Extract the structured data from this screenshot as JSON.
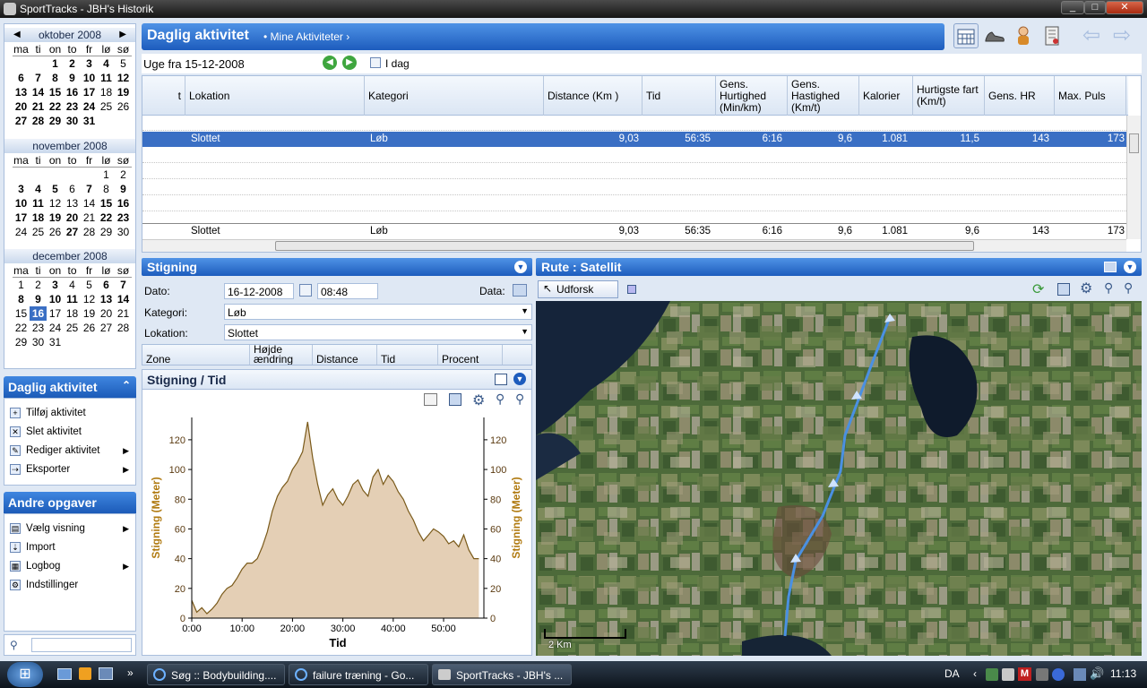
{
  "window": {
    "title": "SportTracks - JBH's Historik",
    "minimize": "_",
    "maximize": "□",
    "close": "✕"
  },
  "calendar": {
    "prev": "◀",
    "next": "▶",
    "weekdays": [
      "ma",
      "ti",
      "on",
      "to",
      "fr",
      "lø",
      "sø"
    ],
    "months": [
      {
        "name": "oktober 2008",
        "days": [
          [
            {
              "d": ""
            },
            {
              "d": ""
            },
            {
              "d": "1",
              "b": true
            },
            {
              "d": "2",
              "b": true
            },
            {
              "d": "3",
              "b": true
            },
            {
              "d": "4",
              "b": true
            },
            {
              "d": "5"
            }
          ],
          [
            {
              "d": "6",
              "b": true
            },
            {
              "d": "7",
              "b": true
            },
            {
              "d": "8",
              "b": true
            },
            {
              "d": "9",
              "b": true
            },
            {
              "d": "10",
              "b": true
            },
            {
              "d": "11",
              "b": true
            },
            {
              "d": "12",
              "b": true
            }
          ],
          [
            {
              "d": "13",
              "b": true
            },
            {
              "d": "14",
              "b": true
            },
            {
              "d": "15",
              "b": true
            },
            {
              "d": "16",
              "b": true
            },
            {
              "d": "17",
              "b": true
            },
            {
              "d": "18"
            },
            {
              "d": "19",
              "b": true
            }
          ],
          [
            {
              "d": "20",
              "b": true
            },
            {
              "d": "21",
              "b": true
            },
            {
              "d": "22",
              "b": true
            },
            {
              "d": "23",
              "b": true
            },
            {
              "d": "24",
              "b": true
            },
            {
              "d": "25"
            },
            {
              "d": "26"
            }
          ],
          [
            {
              "d": "27",
              "b": true
            },
            {
              "d": "28",
              "b": true
            },
            {
              "d": "29",
              "b": true
            },
            {
              "d": "30",
              "b": true
            },
            {
              "d": "31",
              "b": true
            },
            {
              "d": ""
            },
            {
              "d": ""
            }
          ]
        ]
      },
      {
        "name": "november 2008",
        "days": [
          [
            {
              "d": ""
            },
            {
              "d": ""
            },
            {
              "d": ""
            },
            {
              "d": ""
            },
            {
              "d": ""
            },
            {
              "d": "1"
            },
            {
              "d": "2"
            }
          ],
          [
            {
              "d": "3",
              "b": true
            },
            {
              "d": "4",
              "b": true
            },
            {
              "d": "5",
              "b": true
            },
            {
              "d": "6"
            },
            {
              "d": "7",
              "b": true
            },
            {
              "d": "8"
            },
            {
              "d": "9",
              "b": true
            }
          ],
          [
            {
              "d": "10",
              "b": true
            },
            {
              "d": "11",
              "b": true
            },
            {
              "d": "12"
            },
            {
              "d": "13"
            },
            {
              "d": "14"
            },
            {
              "d": "15",
              "b": true
            },
            {
              "d": "16",
              "b": true
            }
          ],
          [
            {
              "d": "17",
              "b": true
            },
            {
              "d": "18",
              "b": true
            },
            {
              "d": "19",
              "b": true
            },
            {
              "d": "20",
              "b": true
            },
            {
              "d": "21"
            },
            {
              "d": "22",
              "b": true
            },
            {
              "d": "23",
              "b": true
            }
          ],
          [
            {
              "d": "24"
            },
            {
              "d": "25"
            },
            {
              "d": "26"
            },
            {
              "d": "27",
              "b": true
            },
            {
              "d": "28"
            },
            {
              "d": "29"
            },
            {
              "d": "30"
            }
          ]
        ]
      },
      {
        "name": "december 2008",
        "days": [
          [
            {
              "d": "1"
            },
            {
              "d": "2"
            },
            {
              "d": "3",
              "b": true
            },
            {
              "d": "4"
            },
            {
              "d": "5"
            },
            {
              "d": "6",
              "b": true
            },
            {
              "d": "7",
              "b": true
            }
          ],
          [
            {
              "d": "8",
              "b": true
            },
            {
              "d": "9",
              "b": true
            },
            {
              "d": "10",
              "b": true
            },
            {
              "d": "11",
              "b": true
            },
            {
              "d": "12"
            },
            {
              "d": "13",
              "b": true
            },
            {
              "d": "14",
              "b": true
            }
          ],
          [
            {
              "d": "15"
            },
            {
              "d": "16",
              "sel": true
            },
            {
              "d": "17"
            },
            {
              "d": "18"
            },
            {
              "d": "19"
            },
            {
              "d": "20"
            },
            {
              "d": "21"
            }
          ],
          [
            {
              "d": "22"
            },
            {
              "d": "23"
            },
            {
              "d": "24"
            },
            {
              "d": "25"
            },
            {
              "d": "26"
            },
            {
              "d": "27"
            },
            {
              "d": "28"
            }
          ],
          [
            {
              "d": "29"
            },
            {
              "d": "30"
            },
            {
              "d": "31"
            },
            {
              "d": ""
            },
            {
              "d": ""
            },
            {
              "d": ""
            },
            {
              "d": ""
            }
          ]
        ]
      }
    ]
  },
  "daily_panel": {
    "title": "Daglig aktivitet",
    "collapse": "⌃",
    "items": [
      {
        "label": "Tilføj aktivitet",
        "icon": "add-activity-icon",
        "arrow": false
      },
      {
        "label": "Slet aktivitet",
        "icon": "delete-icon",
        "arrow": false
      },
      {
        "label": "Rediger aktivitet",
        "icon": "pencil-icon",
        "arrow": true
      },
      {
        "label": "Eksporter",
        "icon": "export-icon",
        "arrow": true
      }
    ]
  },
  "other_panel": {
    "title": "Andre opgaver",
    "items": [
      {
        "label": "Vælg visning",
        "icon": "view-icon",
        "arrow": true
      },
      {
        "label": "Import",
        "icon": "import-icon",
        "arrow": false
      },
      {
        "label": "Logbog",
        "icon": "logbook-icon",
        "arrow": true
      },
      {
        "label": "Indstillinger",
        "icon": "settings-icon",
        "arrow": false
      }
    ]
  },
  "search": {
    "value": ""
  },
  "header": {
    "title": "Daglig aktivitet",
    "subtitle": "• Mine Aktiviteter  ›"
  },
  "toolbar": {
    "back": "⇦",
    "forward": "⇨"
  },
  "week": {
    "label": "Uge fra 15-12-2008",
    "today": "I dag"
  },
  "grid": {
    "columns": [
      "t",
      "Lokation",
      "Kategori",
      "Distance (Km )",
      "Tid",
      "Gens. Hurtighed (Min/km)",
      "Gens. Hastighed (Km/t)",
      "Kalorier",
      "Hurtigste fart (Km/t)",
      "Gens. HR",
      "Max. Puls"
    ],
    "rows": [
      {
        "lokation": "Slottet",
        "kategori": "Løb",
        "distance": "9,03",
        "tid": "56:35",
        "hurtighed": "6:16",
        "hastighed": "9,6",
        "kalorier": "1.081",
        "hurtigste": "11,5",
        "hr": "143",
        "maxpuls": "173"
      }
    ],
    "total": {
      "lokation": "Slottet",
      "kategori": "Løb",
      "distance": "9,03",
      "tid": "56:35",
      "hurtighed": "6:16",
      "hastighed": "9,6",
      "kalorier": "1.081",
      "hurtigste": "9,6",
      "hr": "143",
      "maxpuls": "173"
    }
  },
  "stigning": {
    "title": "Stigning",
    "dato_label": "Dato:",
    "dato": "16-12-2008",
    "time": "08:48",
    "data_label": "Data:",
    "kategori_label": "Kategori:",
    "kategori": "Løb",
    "lokation_label": "Lokation:",
    "lokation": "Slottet",
    "zone_cols": [
      "Zone",
      "Højde ændring",
      "Distance",
      "Tid",
      "Procent"
    ]
  },
  "route": {
    "title": "Rute : Satellit",
    "explore": "Udforsk",
    "scale": "2 Km"
  },
  "chart_panel": {
    "title": "Stigning / Tid"
  },
  "chart_data": {
    "type": "area",
    "title": "Stigning / Tid",
    "xlabel": "Tid",
    "ylabel": "Stigning (Meter)",
    "ylabel_right": "Stigning (Meter)",
    "xlim": [
      0,
      58
    ],
    "ylim": [
      0,
      135
    ],
    "xticks": [
      "0:00",
      "10:00",
      "20:00",
      "30:00",
      "40:00",
      "50:00"
    ],
    "xtick_values": [
      0,
      10,
      20,
      30,
      40,
      50
    ],
    "yticks": [
      0,
      20,
      40,
      60,
      80,
      100,
      120
    ],
    "fill": "#e4cfb5",
    "line": "#7a5a1a",
    "x": [
      0,
      1,
      2,
      3,
      4,
      5,
      6,
      7,
      8,
      9,
      10,
      11,
      12,
      13,
      14,
      15,
      16,
      17,
      18,
      19,
      20,
      21,
      22,
      23,
      24,
      25,
      26,
      27,
      28,
      29,
      30,
      31,
      32,
      33,
      34,
      35,
      36,
      37,
      38,
      39,
      40,
      41,
      42,
      43,
      44,
      45,
      46,
      47,
      48,
      49,
      50,
      51,
      52,
      53,
      54,
      55,
      56,
      57
    ],
    "y": [
      12,
      4,
      7,
      3,
      6,
      10,
      16,
      20,
      22,
      27,
      33,
      37,
      37,
      40,
      48,
      58,
      72,
      82,
      88,
      92,
      100,
      105,
      112,
      132,
      108,
      90,
      76,
      83,
      87,
      80,
      76,
      82,
      90,
      93,
      86,
      82,
      95,
      100,
      90,
      96,
      92,
      85,
      80,
      72,
      66,
      58,
      52,
      56,
      60,
      58,
      55,
      50,
      52,
      48,
      56,
      46,
      40,
      40
    ]
  },
  "taskbar": {
    "start": "⊞",
    "items": [
      "Søg :: Bodybuilding....",
      "failure træning - Go...",
      "SportTracks - JBH's ..."
    ],
    "lang": "DA",
    "clock": "11:13"
  },
  "colors": {
    "accent": "#1d5cbd",
    "selected_row": "#3a6fc4",
    "route": "#4a90e2"
  }
}
